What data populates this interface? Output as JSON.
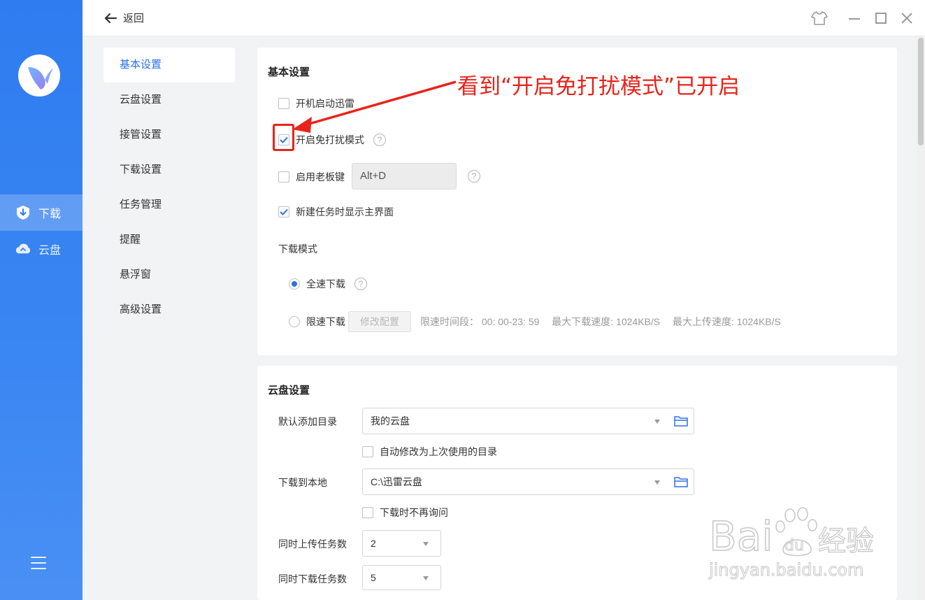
{
  "rail": {
    "items": [
      {
        "label": "下载",
        "active": true
      },
      {
        "label": "云盘",
        "active": false
      }
    ]
  },
  "topbar": {
    "back_label": "返回"
  },
  "nav": {
    "items": [
      "基本设置",
      "云盘设置",
      "接管设置",
      "下载设置",
      "任务管理",
      "提醒",
      "悬浮窗",
      "高级设置"
    ],
    "active_index": 0
  },
  "basic": {
    "title": "基本设置",
    "autostart_label": "开机启动迅雷",
    "autostart_checked": false,
    "dnd_label": "开启免打扰模式",
    "dnd_checked": true,
    "bosskey_label": "启用老板键",
    "bosskey_checked": false,
    "bosskey_value": "Alt+D",
    "show_main_label": "新建任务时显示主界面",
    "show_main_checked": true,
    "download_mode_label": "下载模式",
    "full_speed_label": "全速下载",
    "limit_speed_label": "限速下载",
    "modify_btn": "修改配置",
    "limit_period": "限速时间段： 00: 00-23: 59",
    "max_download": "最大下载速度: 1024KB/S",
    "max_upload": "最大上传速度: 1024KB/S",
    "help_glyph": "?"
  },
  "cloud": {
    "title": "云盘设置",
    "default_dir_label": "默认添加目录",
    "default_dir_value": "我的云盘",
    "auto_modify_label": "自动修改为上次使用的目录",
    "download_local_label": "下载到本地",
    "download_local_value": "C:\\迅雷云盘",
    "no_ask_label": "下载时不再询问",
    "upload_tasks_label": "同时上传任务数",
    "upload_tasks_value": "2",
    "download_tasks_label": "同时下载任务数",
    "download_tasks_value": "5"
  },
  "annotation": {
    "text": "看到“开启免打扰模式”已开启"
  },
  "watermark": {
    "brand": "Bai du 经验",
    "url": "jingyan.baidu.com"
  },
  "colors": {
    "rail_blue": "#2f7cf0",
    "accent": "#2b72e8",
    "annotation_red": "#e8231b"
  }
}
